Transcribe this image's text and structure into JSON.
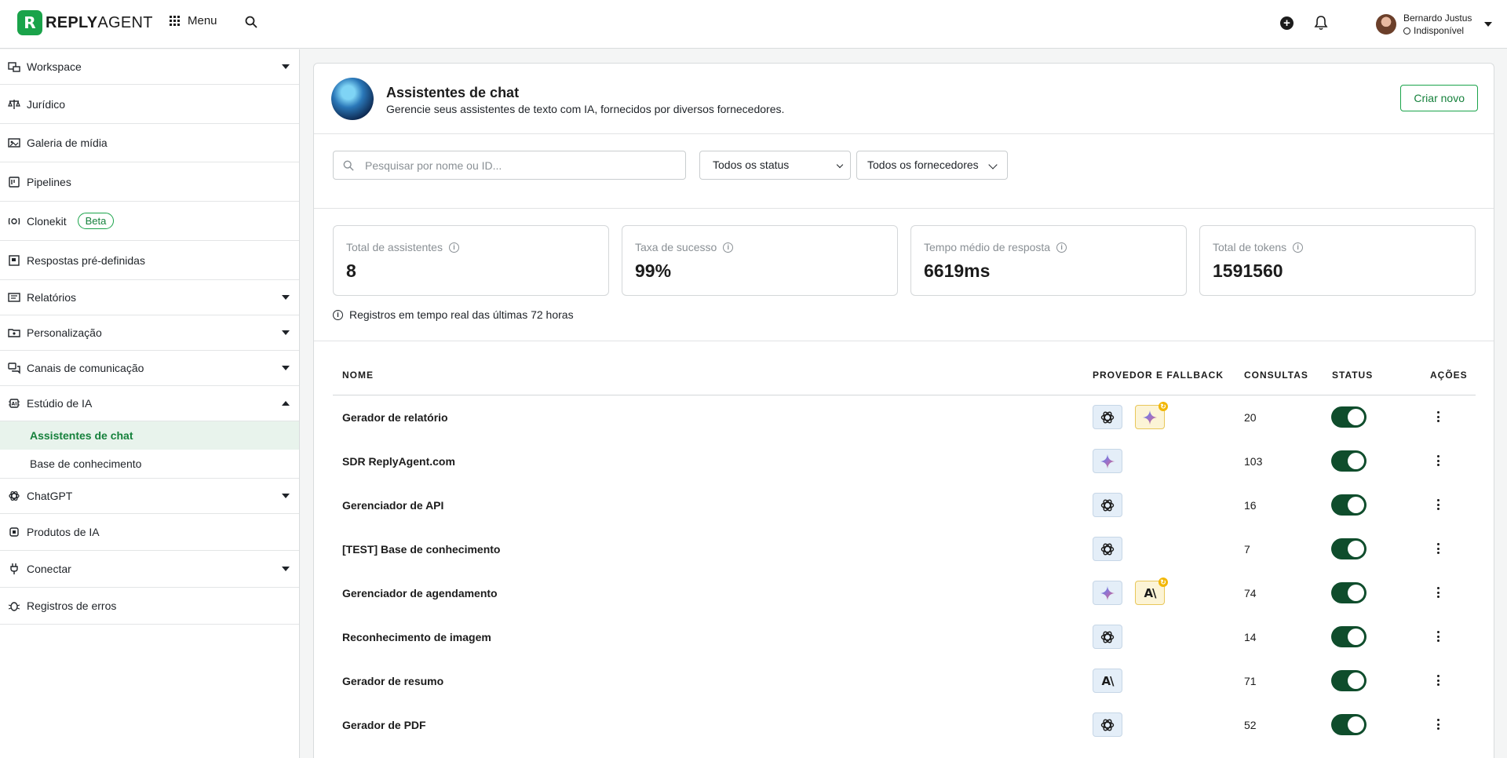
{
  "header": {
    "brand": "REPLYAGENT",
    "menu_label": "Menu",
    "user": {
      "name": "Bernardo Justus",
      "status": "Indisponível"
    }
  },
  "sidebar": {
    "items": [
      {
        "label": "Workspace",
        "icon": "workspace-icon",
        "expandable": true
      },
      {
        "label": "Jurídico",
        "icon": "scale-icon"
      },
      {
        "label": "Galeria de mídia",
        "icon": "media-icon"
      },
      {
        "label": "Pipelines",
        "icon": "pipeline-icon"
      },
      {
        "label": "Clonekit",
        "icon": "clone-icon",
        "badge": "Beta"
      },
      {
        "label": "Respostas pré-definidas",
        "icon": "reply-icon"
      },
      {
        "label": "Relatórios",
        "icon": "report-icon",
        "expandable": true
      },
      {
        "label": "Personalização",
        "icon": "palette-icon",
        "expandable": true
      },
      {
        "label": "Canais de comunicação",
        "icon": "chat-icon",
        "expandable": true
      },
      {
        "label": "Estúdio de IA",
        "icon": "ai-chip-icon",
        "expanded": true,
        "children": [
          {
            "label": "Assistentes de chat",
            "active": true
          },
          {
            "label": "Base de conhecimento"
          }
        ]
      },
      {
        "label": "ChatGPT",
        "icon": "openai-icon",
        "expandable": true
      },
      {
        "label": "Produtos de IA",
        "icon": "chip-icon"
      },
      {
        "label": "Conectar",
        "icon": "plug-icon",
        "expandable": true
      },
      {
        "label": "Registros de erros",
        "icon": "bug-icon"
      }
    ]
  },
  "page": {
    "title": "Assistentes de chat",
    "subtitle": "Gerencie seus assistentes de texto com IA, fornecidos por diversos fornecedores.",
    "create_button": "Criar novo"
  },
  "filters": {
    "search_placeholder": "Pesquisar por nome ou ID...",
    "status_select": "Todos os status",
    "provider_select": "Todos os fornecedores"
  },
  "stats": {
    "cards": [
      {
        "label": "Total de assistentes",
        "value": "8"
      },
      {
        "label": "Taxa de sucesso",
        "value": "99%"
      },
      {
        "label": "Tempo médio de resposta",
        "value": "6619ms"
      },
      {
        "label": "Total de tokens",
        "value": "1591560"
      }
    ],
    "note": "Registros em tempo real das últimas 72 horas"
  },
  "table": {
    "columns": {
      "name": "NOME",
      "provider": "PROVEDOR E FALLBACK",
      "queries": "CONSULTAS",
      "status": "STATUS",
      "actions": "AÇÕES"
    },
    "rows": [
      {
        "name": "Gerador de relatório",
        "provider": "openai",
        "fallback": "gemini",
        "queries": "20",
        "enabled": true
      },
      {
        "name": "SDR ReplyAgent.com",
        "provider": "gemini",
        "fallback": null,
        "queries": "103",
        "enabled": true
      },
      {
        "name": "Gerenciador de API",
        "provider": "openai",
        "fallback": null,
        "queries": "16",
        "enabled": true
      },
      {
        "name": "[TEST] Base de conhecimento",
        "provider": "openai",
        "fallback": null,
        "queries": "7",
        "enabled": true
      },
      {
        "name": "Gerenciador de agendamento",
        "provider": "gemini",
        "fallback": "anthropic",
        "queries": "74",
        "enabled": true
      },
      {
        "name": "Reconhecimento de imagem",
        "provider": "openai",
        "fallback": null,
        "queries": "14",
        "enabled": true
      },
      {
        "name": "Gerador de resumo",
        "provider": "anthropic",
        "fallback": null,
        "queries": "71",
        "enabled": true
      },
      {
        "name": "Gerador de PDF",
        "provider": "openai",
        "fallback": null,
        "queries": "52",
        "enabled": true
      }
    ]
  },
  "colors": {
    "brand_green": "#1aa34a",
    "toggle_on": "#0f4d2c",
    "active_bg": "#e8f3ec"
  }
}
